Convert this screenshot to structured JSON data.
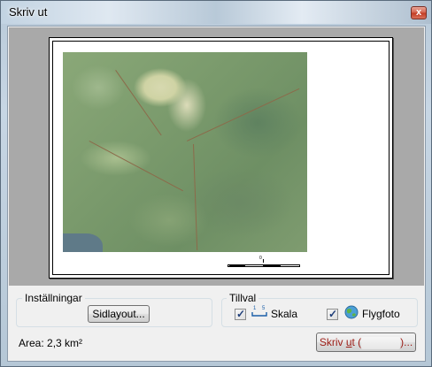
{
  "window": {
    "title": "Skriv ut",
    "close_glyph": "x"
  },
  "settings_group": {
    "title": "Inställningar",
    "page_layout_button": "Sidlayout..."
  },
  "options_group": {
    "title": "Tillval",
    "scale_checked": true,
    "scale_label": "Skala",
    "scale_icon": "scale-ruler-icon",
    "aerial_checked": true,
    "aerial_label": "Flygfoto",
    "aerial_icon": "globe-icon"
  },
  "area_text": "Area: 2,3 km²",
  "print_button": {
    "label_prefix": "Skriv ",
    "label_underlined": "u",
    "label_suffix": "t (",
    "label_end": ")..."
  },
  "preview": {
    "scalebar_label": "0"
  }
}
